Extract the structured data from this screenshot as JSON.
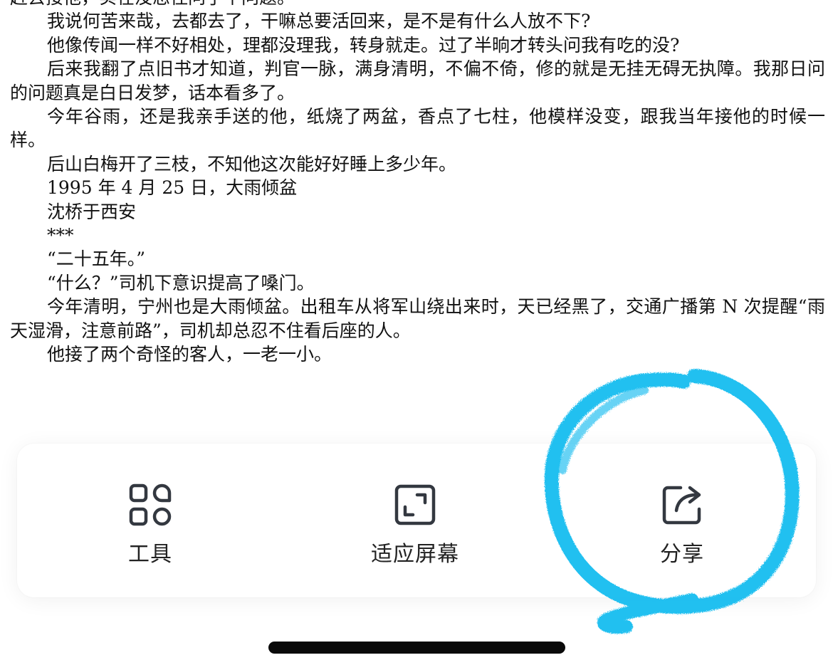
{
  "document": {
    "paragraphs": [
      {
        "text": "赶去接他，实在没忍住问了个问题。",
        "style": "flush"
      },
      {
        "text": "我说何苦来哉，去都去了，干嘛总要活回来，是不是有什么人放不下?",
        "style": "indent"
      },
      {
        "text": "他像传闻一样不好相处，理都没理我，转身就走。过了半晌才转头问我有吃的没?",
        "style": "indent"
      },
      {
        "text": "后来我翻了点旧书才知道，判官一脉，满身清明，不偏不倚，修的就是无挂无碍无执障。我那日问的问题真是白日发梦，话本看多了。",
        "style": "indent"
      },
      {
        "text": "今年谷雨，还是我亲手送的他，纸烧了两盆，香点了七柱，他模样没变，跟我当年接他的时候一样。",
        "style": "indent"
      },
      {
        "text": "后山白梅开了三枝，不知他这次能好好睡上多少年。",
        "style": "indent"
      },
      {
        "text": "1995 年 4 月 25 日，大雨倾盆",
        "style": "block"
      },
      {
        "text": "沈桥于西安",
        "style": "block"
      },
      {
        "text": "***",
        "style": "block"
      },
      {
        "text": "“二十五年。”",
        "style": "block"
      },
      {
        "text": "“什么？”司机下意识提高了嗓门。",
        "style": "block"
      },
      {
        "text": "今年清明，宁州也是大雨倾盆。出租车从将军山绕出来时，天已经黑了，交通广播第 N 次提醒“雨天湿滑，注意前路”，司机却总忍不住看后座的人。",
        "style": "indent"
      },
      {
        "text": "他接了两个奇怪的客人，一老一小。",
        "style": "indent"
      }
    ]
  },
  "toolbar": {
    "items": [
      {
        "id": "tools",
        "label": "工具",
        "icon": "tools-grid-icon"
      },
      {
        "id": "fit",
        "label": "适应屏幕",
        "icon": "fit-screen-icon"
      },
      {
        "id": "share",
        "label": "分享",
        "icon": "share-icon"
      }
    ]
  },
  "annotation": {
    "color": "#19bdf0",
    "shape": "hand-drawn circle around share"
  },
  "colors": {
    "text": "#111111",
    "icon": "#333840",
    "home_indicator": "#0a0a0a"
  }
}
